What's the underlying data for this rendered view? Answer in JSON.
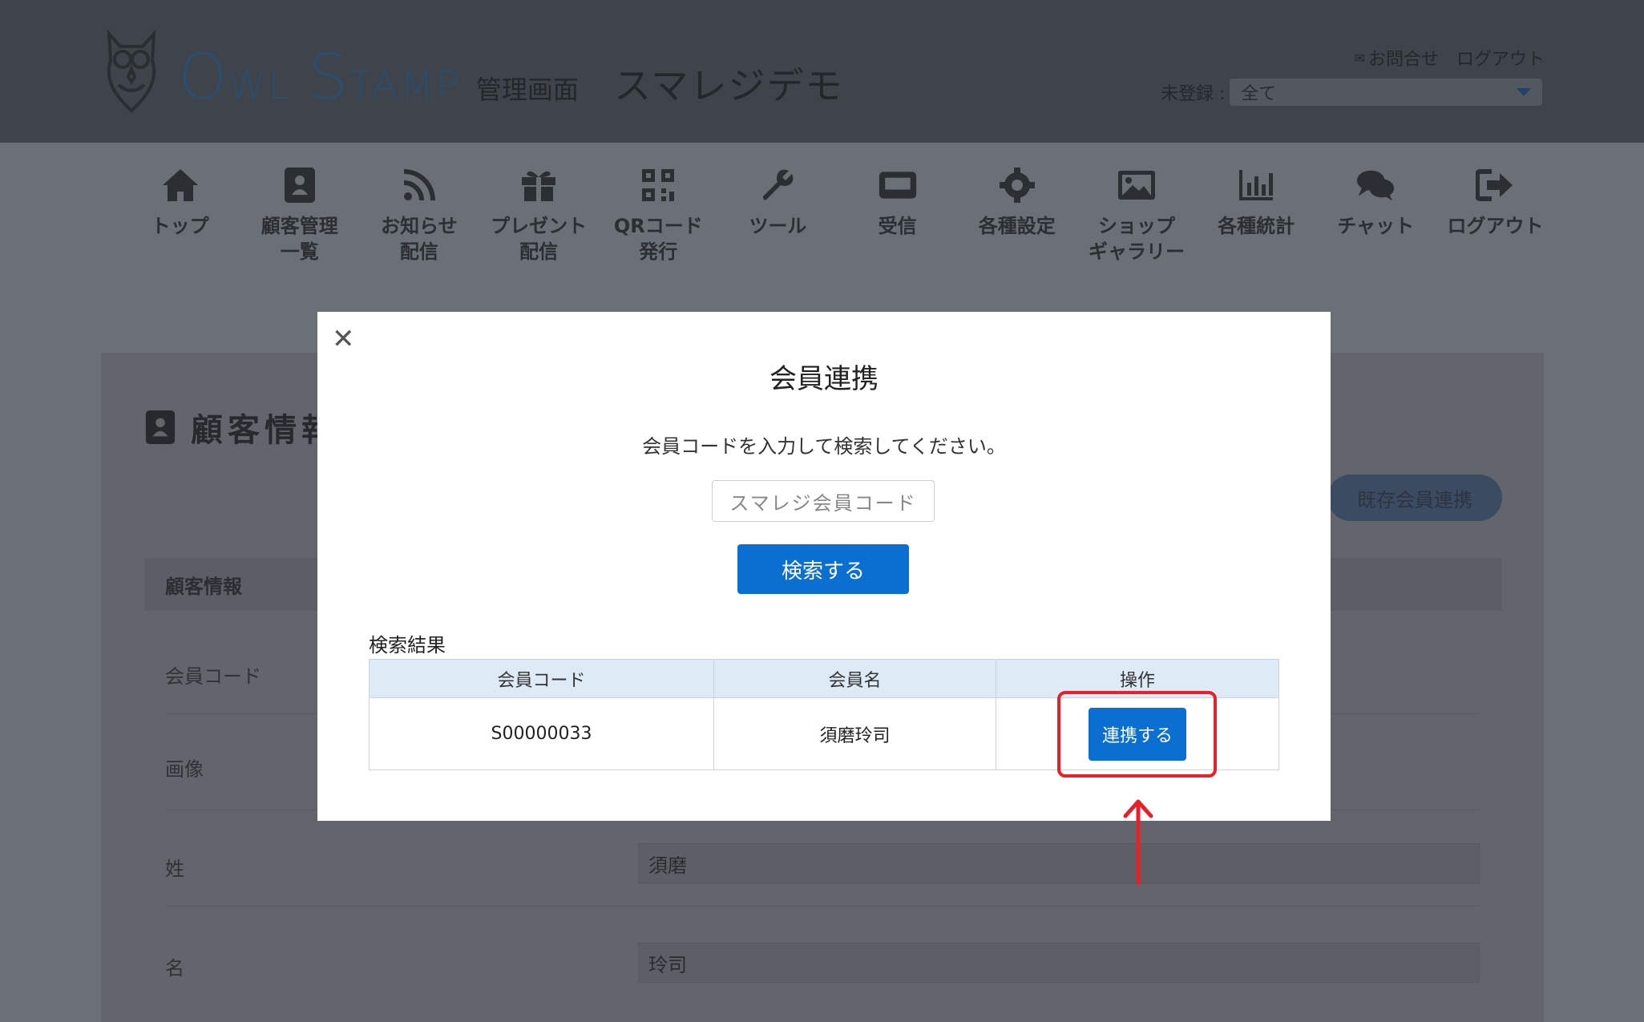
{
  "header": {
    "brand_o": "O",
    "brand_wl": "WL",
    "brand_s": "S",
    "brand_tamp": "TAMP",
    "brand_tag": "管理画面",
    "shop_name": "スマレジデモ",
    "contact_label": "お問合せ",
    "logout_label": "ログアウト",
    "unregistered_label": "未登録 :",
    "unregistered_value": "全て"
  },
  "nav": {
    "items": [
      {
        "label": "トップ",
        "icon": "home-icon"
      },
      {
        "label": "顧客管理\n一覧",
        "icon": "address-book-icon"
      },
      {
        "label": "お知らせ\n配信",
        "icon": "rss-icon"
      },
      {
        "label": "プレゼント\n配信",
        "icon": "gift-icon"
      },
      {
        "label": "QRコード\n発行",
        "icon": "qrcode-icon"
      },
      {
        "label": "ツール",
        "icon": "wrench-icon"
      },
      {
        "label": "受信",
        "icon": "inbox-icon"
      },
      {
        "label": "各種設定",
        "icon": "gear-icon"
      },
      {
        "label": "ショップ\nギャラリー",
        "icon": "image-icon"
      },
      {
        "label": "各種統計",
        "icon": "bar-chart-icon"
      },
      {
        "label": "チャット",
        "icon": "chat-icon"
      },
      {
        "label": "ログアウト",
        "icon": "sign-out-icon"
      }
    ]
  },
  "background": {
    "title": "顧客情報",
    "existing_link_button": "既存会員連携",
    "section": "顧客情報",
    "fields": {
      "member_code_label": "会員コード",
      "image_label": "画像",
      "last_name_label": "姓",
      "last_name_value": "須磨",
      "first_name_label": "名",
      "first_name_value": "玲司"
    }
  },
  "modal": {
    "title": "会員連携",
    "instruction": "会員コードを入力して検索してください。",
    "input_placeholder": "スマレジ会員コード",
    "search_button": "検索する",
    "results_label": "検索結果",
    "columns": [
      "会員コード",
      "会員名",
      "操作"
    ],
    "rows": [
      {
        "code": "S00000033",
        "name": "須磨玲司",
        "action": "連携する"
      }
    ]
  },
  "colors": {
    "primary": "#0a6fd1",
    "highlight": "#e8202a",
    "header_bg": "#3f434a"
  }
}
